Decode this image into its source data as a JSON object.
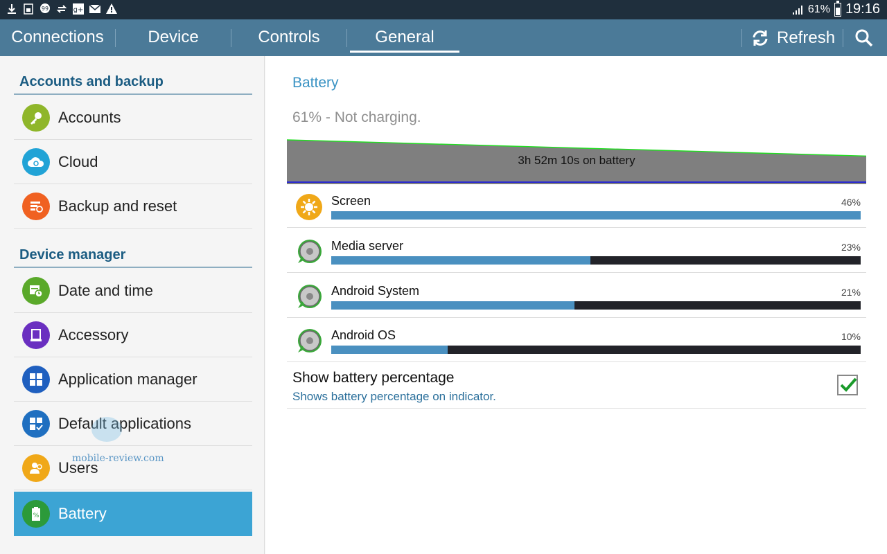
{
  "status_bar": {
    "battery_percent_text": "61%",
    "time": "19:16",
    "icons": [
      "download-icon",
      "sim-icon",
      "chat-icon",
      "sync-icon",
      "google-plus-icon",
      "mail-icon",
      "warning-icon",
      "signal-icon",
      "battery-icon"
    ]
  },
  "tabs": [
    {
      "label": "Connections"
    },
    {
      "label": "Device"
    },
    {
      "label": "Controls"
    },
    {
      "label": "General",
      "active": true
    }
  ],
  "actions": {
    "refresh_label": "Refresh"
  },
  "sidebar": {
    "sections": [
      {
        "header": "Accounts and backup",
        "items": [
          {
            "label": "Accounts",
            "icon": "key-icon",
            "color": "#8fb62a"
          },
          {
            "label": "Cloud",
            "icon": "cloud-icon",
            "color": "#21a3d6"
          },
          {
            "label": "Backup and reset",
            "icon": "backup-icon",
            "color": "#f06121"
          }
        ]
      },
      {
        "header": "Device manager",
        "items": [
          {
            "label": "Date and time",
            "icon": "calendar-clock-icon",
            "color": "#5aa92a"
          },
          {
            "label": "Accessory",
            "icon": "accessory-icon",
            "color": "#6a2fc0"
          },
          {
            "label": "Application manager",
            "icon": "grid-icon",
            "color": "#1f5fbf"
          },
          {
            "label": "Default applications",
            "icon": "default-apps-icon",
            "color": "#1f6fc0"
          },
          {
            "label": "Users",
            "icon": "users-icon",
            "color": "#f0a818"
          },
          {
            "label": "Battery",
            "icon": "battery-icon",
            "color": "#2c9a3a",
            "active": true
          }
        ]
      }
    ]
  },
  "watermark": "mobile-review.com",
  "battery": {
    "title": "Battery",
    "status": "61% - Not charging.",
    "graph_label": "3h 52m 10s on battery",
    "graph_start_level": 100,
    "graph_end_level": 61,
    "usage": [
      {
        "name": "Screen",
        "percent_text": "46%",
        "fraction": 1.0,
        "icon": "screen-brightness-icon"
      },
      {
        "name": "Media server",
        "percent_text": "23%",
        "fraction": 0.49,
        "icon": "android-app-icon"
      },
      {
        "name": "Android System",
        "percent_text": "21%",
        "fraction": 0.46,
        "icon": "android-app-icon"
      },
      {
        "name": "Android OS",
        "percent_text": "10%",
        "fraction": 0.22,
        "icon": "android-app-icon"
      }
    ],
    "show_percentage": {
      "title": "Show battery percentage",
      "summary": "Shows battery percentage on indicator.",
      "checked": true
    }
  },
  "colors": {
    "action_bar": "#4b7a98",
    "accent": "#3a93c4",
    "active_item": "#3ca4d4",
    "usage_fill": "#4a90c0",
    "check": "#1a9a2a"
  }
}
